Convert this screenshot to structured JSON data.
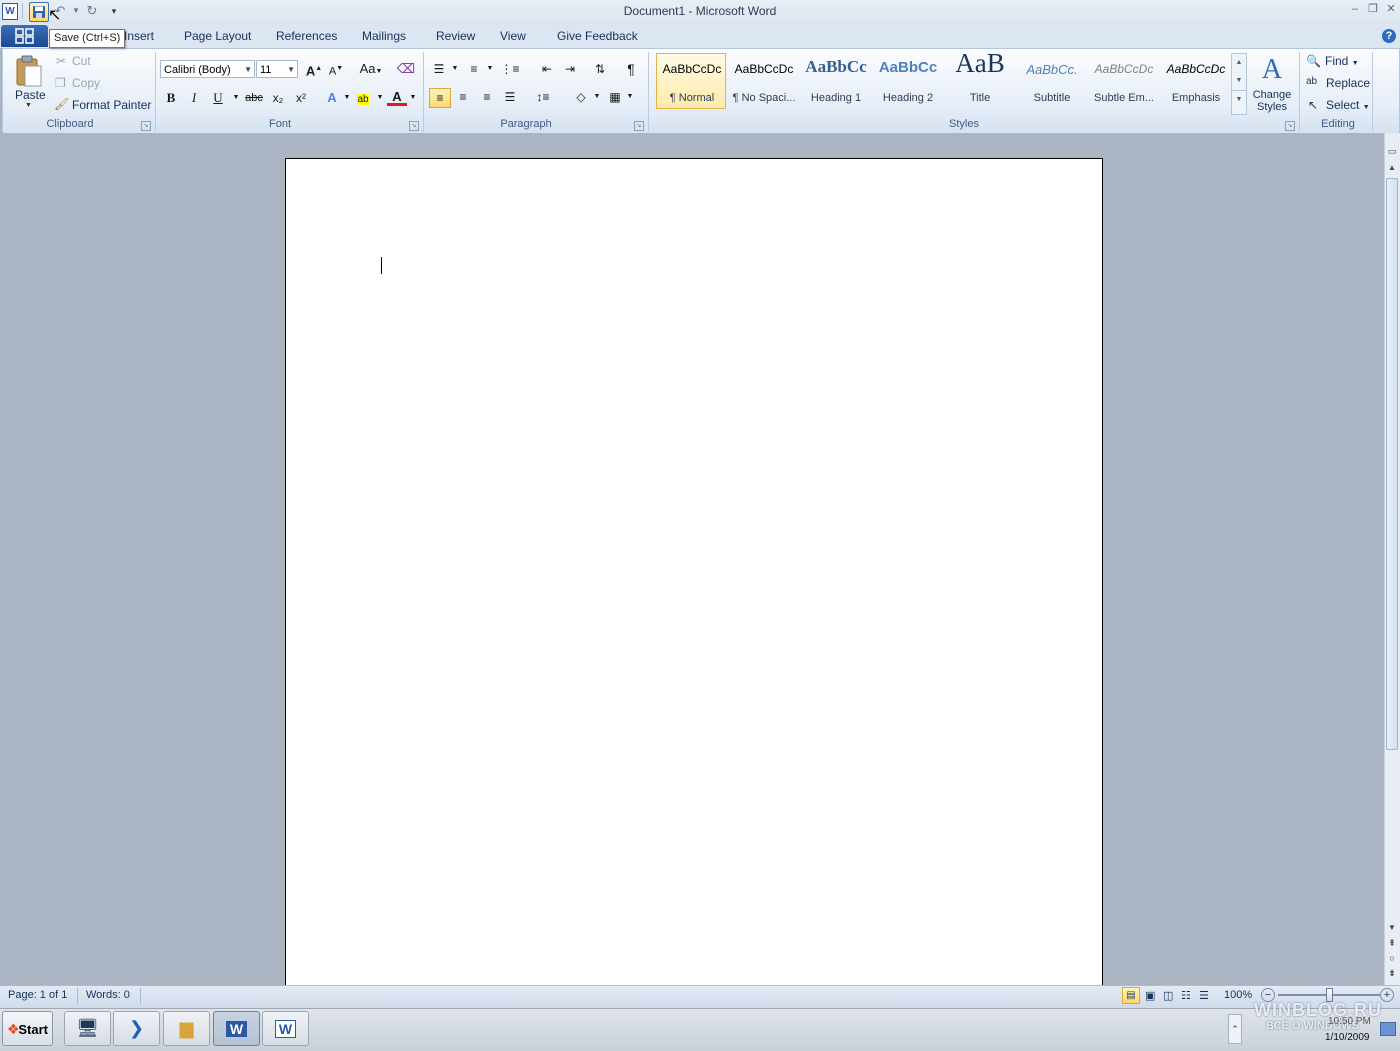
{
  "title_bar": {
    "window_title": "Document1  -  Microsoft Word",
    "app_icon_letter": "W"
  },
  "tooltip": {
    "text": "Save (Ctrl+S)"
  },
  "tabs": [
    {
      "label": "Insert"
    },
    {
      "label": "Page Layout"
    },
    {
      "label": "References"
    },
    {
      "label": "Mailings"
    },
    {
      "label": "Review"
    },
    {
      "label": "View"
    },
    {
      "label": "Give Feedback"
    }
  ],
  "clipboard": {
    "paste": "Paste",
    "cut": "Cut",
    "copy": "Copy",
    "format_painter": "Format Painter",
    "group_label": "Clipboard"
  },
  "font": {
    "font_name": "Calibri (Body)",
    "font_size": "11",
    "group_label": "Font",
    "change_case": "Aa",
    "bold": "B",
    "italic": "I",
    "underline": "U",
    "strikethrough": "abc",
    "grow_font": "A",
    "shrink_font": "A"
  },
  "paragraph": {
    "group_label": "Paragraph",
    "pilcrow": "¶"
  },
  "styles": {
    "group_label": "Styles",
    "items": [
      {
        "preview": "AaBbCcDc",
        "label": "¶ Normal",
        "selected": true
      },
      {
        "preview": "AaBbCcDc",
        "label": "¶ No Spaci..."
      },
      {
        "preview": "AaBbCc",
        "label": "Heading 1"
      },
      {
        "preview": "AaBbCc",
        "label": "Heading 2"
      },
      {
        "preview": "AaB",
        "label": "Title"
      },
      {
        "preview": "AaBbCc.",
        "label": "Subtitle"
      },
      {
        "preview": "AaBbCcDc",
        "label": "Subtle Em..."
      },
      {
        "preview": "AaBbCcDc",
        "label": "Emphasis"
      }
    ],
    "change_styles": "Change Styles"
  },
  "editing": {
    "group_label": "Editing",
    "find": "Find",
    "replace": "Replace",
    "select": "Select"
  },
  "status_bar": {
    "page": "Page: 1 of 1",
    "words": "Words: 0",
    "zoom": "100%",
    "zoom_level_percent": 100
  },
  "taskbar": {
    "start": "Start",
    "clock_time": "10:50 PM",
    "clock_date": "1/10/2009"
  },
  "watermark": {
    "line1": "WINBLOG.RU",
    "line2": "ВСЁ О WINDOWS"
  },
  "colors": {
    "ribbon_bg": "#e5edf7",
    "workspace_bg": "#abb4c2",
    "selected_style": "#ffeaa9",
    "accent": "#2a5aa6"
  }
}
